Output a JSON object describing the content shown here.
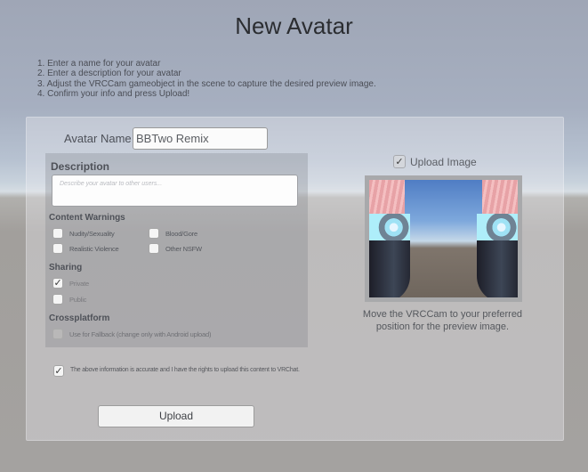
{
  "title": "New Avatar",
  "instructions": [
    "1. Enter a name for your avatar",
    "2. Enter a description for your avatar",
    "3. Adjust the VRCCam gameobject in the scene to capture the desired preview image.",
    "4. Confirm your info and press Upload!"
  ],
  "avatar_name": {
    "label": "Avatar Name",
    "value": "BBTwo Remix"
  },
  "description": {
    "heading": "Description",
    "value": "",
    "placeholder": "Describe your avatar to other users..."
  },
  "content_warnings": {
    "heading": "Content Warnings",
    "options": [
      {
        "label": "Nudity/Sexuality",
        "checked": false
      },
      {
        "label": "Blood/Gore",
        "checked": false
      },
      {
        "label": "Realistic Violence",
        "checked": false
      },
      {
        "label": "Other NSFW",
        "checked": false
      }
    ]
  },
  "sharing": {
    "heading": "Sharing",
    "options": [
      {
        "label": "Private",
        "checked": true
      },
      {
        "label": "Public",
        "checked": false
      }
    ]
  },
  "crossplatform": {
    "heading": "Crossplatform",
    "fallback_label": "Use for Fallback (change only with Android upload)",
    "fallback_checked": false,
    "fallback_enabled": false
  },
  "agreement": {
    "label": "The above information is accurate and I have the rights to upload this content to VRChat.",
    "checked": true
  },
  "upload_button": "Upload",
  "upload_image": {
    "label": "Upload Image",
    "checked": true
  },
  "preview_hint": "Move the VRCCam to your preferred position for the preview image.",
  "check_glyph": "✓"
}
